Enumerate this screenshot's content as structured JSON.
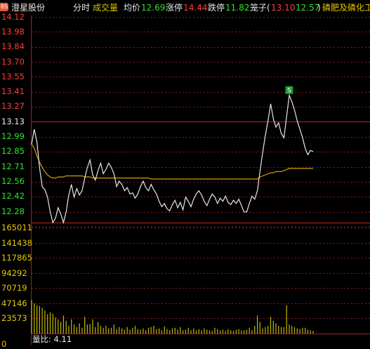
{
  "header": {
    "badge": "8S",
    "stock_name": "澄星股份",
    "tab_intraday": "分时",
    "tab_volume": "成交量",
    "avg_label": "均价",
    "avg_value": "12.69",
    "limit_up_label": "涨停",
    "limit_up_value": "14.44",
    "limit_down_label": "跌停",
    "limit_down_value": "11.82",
    "cage_label": "笼子(",
    "cage_high": "13.10",
    "cage_low": "12.57",
    "cage_close": ")",
    "sector": "磷肥及磷化工"
  },
  "price_axis": [
    "14.12",
    "13.98",
    "13.84",
    "13.70",
    "13.55",
    "13.41",
    "13.27",
    "13.13",
    "12.99",
    "12.85",
    "12.71",
    "12.56",
    "12.42",
    "12.28"
  ],
  "volume_axis": [
    "165011",
    "141438",
    "117865",
    "94292",
    "70719",
    "47146",
    "23573",
    "0"
  ],
  "signal_badge": "S",
  "footer": {
    "label": "量比:",
    "value": "4.11"
  },
  "colors": {
    "up": "#ff3b3b",
    "down": "#2ee62e",
    "neutral": "#e8e8e8",
    "avg_line": "#d6a000",
    "grid": "#8b1a1a",
    "volume": "#c8b800"
  },
  "chart_data": [
    {
      "type": "line",
      "title": "分时",
      "ylim": [
        12.14,
        14.12
      ],
      "reference_price": 13.13,
      "series": [
        {
          "name": "price",
          "values": [
            12.92,
            13.06,
            12.94,
            12.7,
            12.52,
            12.49,
            12.42,
            12.28,
            12.18,
            12.22,
            12.32,
            12.26,
            12.18,
            12.28,
            12.44,
            12.54,
            12.42,
            12.5,
            12.44,
            12.48,
            12.6,
            12.7,
            12.77,
            12.63,
            12.58,
            12.67,
            12.74,
            12.64,
            12.68,
            12.74,
            12.7,
            12.64,
            12.52,
            12.57,
            12.54,
            12.48,
            12.51,
            12.45,
            12.46,
            12.41,
            12.45,
            12.52,
            12.57,
            12.51,
            12.48,
            12.54,
            12.49,
            12.45,
            12.38,
            12.33,
            12.36,
            12.31,
            12.29,
            12.35,
            12.39,
            12.32,
            12.37,
            12.3,
            12.42,
            12.38,
            12.33,
            12.4,
            12.45,
            12.48,
            12.44,
            12.38,
            12.34,
            12.4,
            12.45,
            12.42,
            12.36,
            12.41,
            12.38,
            12.43,
            12.37,
            12.35,
            12.39,
            12.36,
            12.4,
            12.34,
            12.28,
            12.28,
            12.36,
            12.43,
            12.4,
            12.48,
            12.66,
            12.84,
            13.0,
            13.14,
            13.3,
            13.16,
            13.08,
            13.12,
            13.02,
            12.98,
            13.18,
            13.38,
            13.32,
            13.24,
            13.14,
            13.06,
            12.98,
            12.88,
            12.82,
            12.86,
            12.85
          ]
        },
        {
          "name": "avg",
          "values": [
            12.92,
            12.88,
            12.81,
            12.75,
            12.7,
            12.66,
            12.63,
            12.61,
            12.6,
            12.6,
            12.61,
            12.61,
            12.61,
            12.62,
            12.62,
            12.62,
            12.62,
            12.62,
            12.62,
            12.62,
            12.61,
            12.61,
            12.61,
            12.6,
            12.6,
            12.6,
            12.6,
            12.6,
            12.6,
            12.6,
            12.6,
            12.6,
            12.6,
            12.6,
            12.6,
            12.6,
            12.6,
            12.6,
            12.6,
            12.6,
            12.6,
            12.6,
            12.6,
            12.6,
            12.6,
            12.59,
            12.59,
            12.59,
            12.59,
            12.59,
            12.59,
            12.59,
            12.59,
            12.59,
            12.59,
            12.59,
            12.59,
            12.59,
            12.59,
            12.59,
            12.59,
            12.59,
            12.59,
            12.59,
            12.59,
            12.59,
            12.59,
            12.59,
            12.59,
            12.59,
            12.59,
            12.59,
            12.59,
            12.59,
            12.59,
            12.59,
            12.59,
            12.59,
            12.59,
            12.59,
            12.59,
            12.59,
            12.59,
            12.59,
            12.59,
            12.59,
            12.61,
            12.62,
            12.63,
            12.64,
            12.65,
            12.65,
            12.66,
            12.66,
            12.66,
            12.67,
            12.68,
            12.69,
            12.69,
            12.69,
            12.69,
            12.69,
            12.69,
            12.69,
            12.69,
            12.69,
            12.69
          ]
        }
      ]
    },
    {
      "type": "bar",
      "title": "成交量",
      "ylim": [
        0,
        165011
      ],
      "values": [
        52000,
        47000,
        44000,
        43000,
        40000,
        36000,
        30000,
        33000,
        31000,
        25000,
        22000,
        18000,
        28000,
        20000,
        12000,
        22000,
        14000,
        10000,
        16000,
        9000,
        26000,
        14000,
        15000,
        22000,
        10000,
        18000,
        12000,
        9000,
        12000,
        8000,
        9000,
        14000,
        7000,
        10000,
        8000,
        6000,
        10000,
        6000,
        9000,
        12000,
        7000,
        6000,
        8000,
        5000,
        9000,
        10000,
        12000,
        7000,
        8000,
        5000,
        11000,
        7000,
        5000,
        8000,
        9000,
        6000,
        10000,
        5000,
        6000,
        9000,
        5000,
        8000,
        5000,
        7000,
        5000,
        8000,
        6000,
        5000,
        4000,
        9000,
        7000,
        5000,
        6000,
        4000,
        7000,
        5000,
        4000,
        6000,
        7000,
        5000,
        5000,
        6000,
        9000,
        5000,
        12000,
        28000,
        18000,
        8000,
        10000,
        12000,
        26000,
        20000,
        16000,
        12000,
        10000,
        10000,
        44000,
        14000,
        12000,
        10000,
        8000,
        7000,
        9000,
        9000,
        6000,
        5000,
        4000
      ]
    }
  ]
}
